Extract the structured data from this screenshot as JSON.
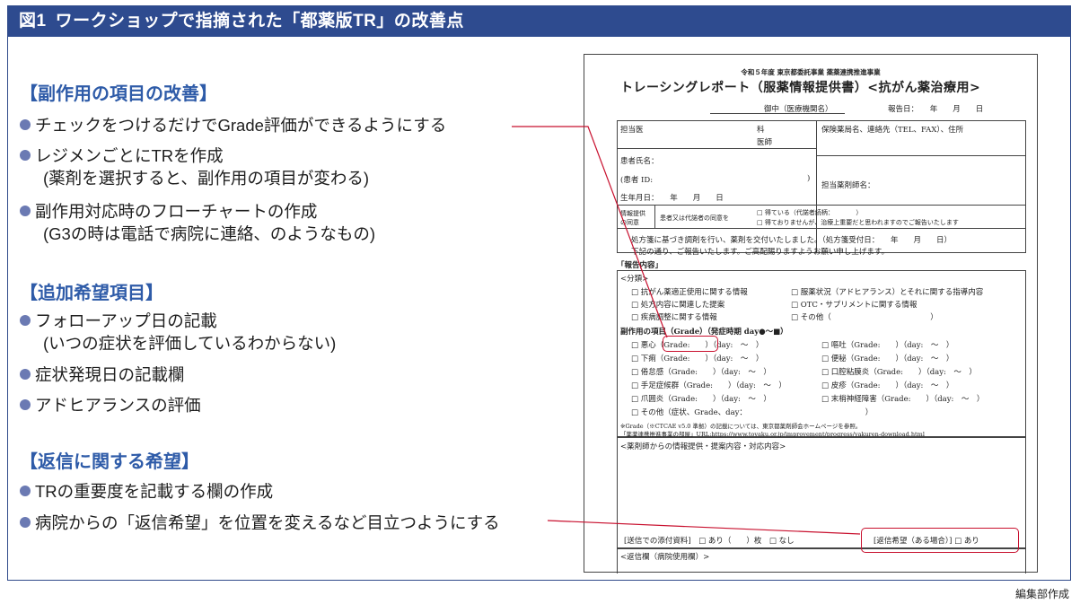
{
  "header": {
    "fig_no": "図1",
    "title": "ワークショップで指摘された「都薬版TR」の改善点"
  },
  "sections": [
    {
      "title": "【副作用の項目の改善】",
      "items": [
        {
          "text": "チェックをつけるだけでGrade評価ができるようにする"
        },
        {
          "text": "レジメンごとにTRを作成",
          "sub": "(薬剤を選択すると、副作用の項目が変わる)"
        },
        {
          "text": "副作用対応時のフローチャートの作成",
          "sub": "(G3の時は電話で病院に連絡、のようなもの)"
        }
      ]
    },
    {
      "title": "【追加希望項目】",
      "items": [
        {
          "text": "フォローアップ日の記載",
          "sub": "(いつの症状を評価しているわからない)"
        },
        {
          "text": "症状発現日の記載欄"
        },
        {
          "text": "アドヒアランスの評価"
        }
      ]
    },
    {
      "title": "【返信に関する希望】",
      "items": [
        {
          "text": "TRの重要度を記載する欄の作成"
        },
        {
          "text": "病院からの「返信希望」を位置を変えるなど目立つようにする"
        }
      ]
    }
  ],
  "form": {
    "subtitle": "令和５年度 東京都委託事業 薬薬連携推進事業",
    "title": "トレーシングレポート（服薬情報提供書）<抗がん薬治療用>",
    "to": "御中（医療機関名）",
    "report_date": "報告日：　　年　　月　　日",
    "doctor": "担当医",
    "dept": "科",
    "physician": "医師",
    "pharmacy": "保険薬局名、連絡先（TEL、FAX）、住所",
    "patient_name": "患者氏名：",
    "patient_id": "(患者 ID:",
    "paren_close": ")",
    "birth": "生年月日：　　年　　月　　日",
    "pharmacist": "担当薬剤師名：",
    "consent_label_1": "情報提供",
    "consent_label_2": "の同意",
    "consent_q": "患者又は代諾者の同意を",
    "consent_a": "□ 得ている（代諾者続柄：　　　　）",
    "consent_b": "□ 得ておりませんが、治療上重要だと思われますのでご報告いたします",
    "dispense_1": "処方箋に基づき調剤を行い、薬剤を交付いたしました。（処方箋受付日：　　年　　月　　日）",
    "dispense_2": "下記の通り、ご報告いたします。ご高配賜りますようお願い申し上げます。",
    "report_content": "「報告内容」",
    "category": "<分類>",
    "cats": [
      "□ 抗がん薬適正使用に関する情報",
      "□ 服薬状況（アドヒアランス）とそれに関する指導内容",
      "□ 処方内容に関連した提案",
      "□ OTC・サプリメントに関する情報",
      "□ 疾病調整に関する情報",
      "□ その他（　　　　　　　　　　　　　）"
    ],
    "se_header": "副作用の項目（Grade）（発症時期 day●〜■）",
    "se_left": [
      "□ 悪心（Grade:　　）（day:　〜　）",
      "□ 下痢（Grade:　　）（day:　〜　）",
      "□ 倦怠感（Grade:　　）（day:　〜　）",
      "□ 手足症候群（Grade:　　）（day:　〜　）",
      "□ 爪囲炎（Grade:　　）（day:　〜　）",
      "□ その他（症状、Grade、day：　　　　　　　　　　　　　　　　）"
    ],
    "se_right": [
      "□ 嘔吐（Grade:　　）（day:　〜　）",
      "□ 便秘（Grade:　　）（day:　〜　）",
      "□ 口腔粘膜炎（Grade:　　）（day:　〜　）",
      "□ 皮疹（Grade:　　）（day:　〜　）",
      "□ 末梢神経障害（Grade:　　）（day:　〜　）"
    ],
    "note_1": "※Grade（※CTCAE v5.0 準拠）の記載については、東京都薬剤師会ホームページを参照。",
    "note_2": "「薬薬連携推進事業の部屋」URL:https://www.toyaku.or.jp/improvement/progress/yakuren-download.html",
    "pharmacist_info": "<薬剤師からの情報提供・提案内容・対応内容>",
    "attach": "[送信での添付資料]　□ あり（　　）枚　□ なし",
    "reply_wish": "[返信希望（ある場合）] □ あり",
    "reply_box": "<返信欄（病院使用欄）>"
  },
  "credit": "編集部作成",
  "colors": {
    "header_bg": "#2e4b8f",
    "section_title": "#2e5ba8",
    "bullet": "#6b7ab3",
    "highlight": "#c8102e"
  }
}
